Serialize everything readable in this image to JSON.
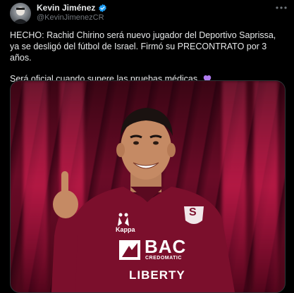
{
  "author": {
    "display_name": "Kevin Jiménez",
    "handle": "@KevinJimenezCR"
  },
  "icons": {
    "verified": "verified-badge-icon",
    "more": "more-options-icon",
    "heart": "purple-heart-emoji"
  },
  "tweet": {
    "paragraph_1": "HECHO: Rachid Chirino será nuevo jugador del Deportivo Saprissa, ya se desligó del fútbol de Israel. Firmó su PRECONTRATO por 3 años.",
    "paragraph_2": "Será oficial cuando supere las pruebas médicas."
  },
  "media": {
    "jersey_brand": "Kappa",
    "jersey_crest": "S",
    "sponsor_1": "BAC",
    "sponsor_1_sub": "CREDOMATIC",
    "sponsor_2": "LIBERTY"
  },
  "colors": {
    "background": "#000000",
    "verified_blue": "#1d9bf0",
    "heart_purple": "#b07cf0",
    "jersey_maroon": "#7b0f2c"
  }
}
